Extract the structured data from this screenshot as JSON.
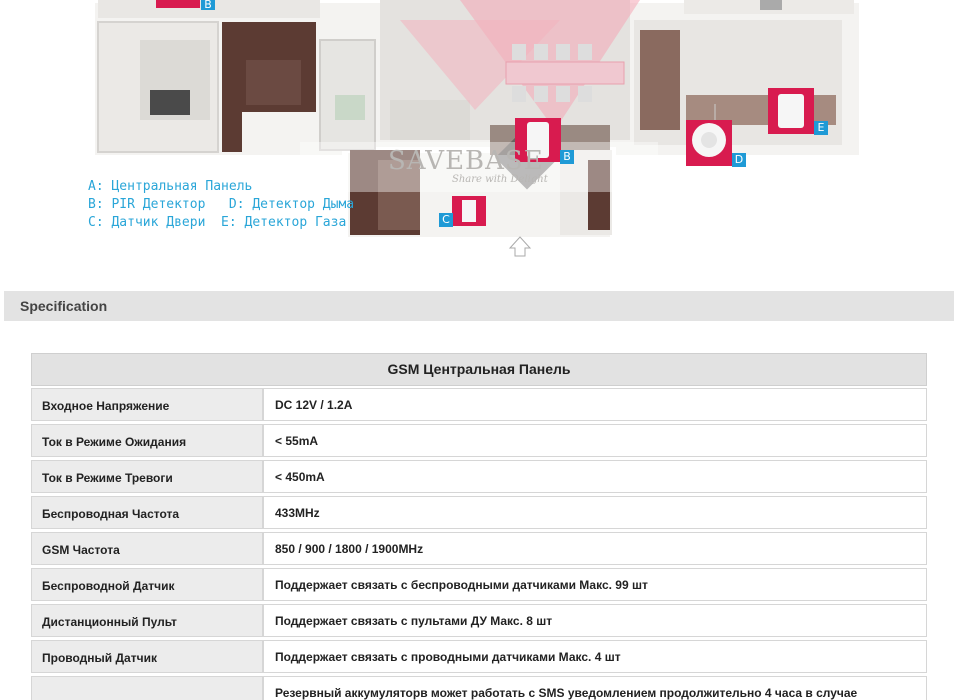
{
  "plan": {
    "watermark": "SAVEBASE",
    "watermark_sub": "Share with Delight",
    "markers": [
      "B",
      "B",
      "C",
      "D",
      "E"
    ],
    "legend": [
      "A: Центральная Панель",
      "B: PIR Детектор   D: Детектор Дыма",
      "C: Датчик Двери  E: Детектор Газа"
    ],
    "colors": {
      "legend_text": "#2aa6d8",
      "marker_bg": "#1f9ad6",
      "device_frame": "#d81b4f"
    }
  },
  "spec": {
    "title": "Specification"
  },
  "table": {
    "header": "GSM Центральная Панель",
    "rows": [
      {
        "label": "Входное Напряжение",
        "value": "DC 12V / 1.2A"
      },
      {
        "label": "Ток в Режиме Ожидания",
        "value": "< 55mA"
      },
      {
        "label": "Ток в Режиме Тревоги",
        "value": "< 450mA"
      },
      {
        "label": "Беспроводная Частота",
        "value": "433MHz"
      },
      {
        "label": "GSM Частота",
        "value": "850 / 900 / 1800 / 1900MHz"
      },
      {
        "label": "Беспроводной Датчик",
        "value": "Поддержает связать с беспроводными датчиками Макс. 99 шт"
      },
      {
        "label": "Дистанционный Пульт",
        "value": "Поддержает связать с пультами ДУ Макс. 8 шт"
      },
      {
        "label": "Проводный Датчик",
        "value": "Поддержает связать с проводными датчиками Макс. 4 шт"
      },
      {
        "label": "",
        "value": "Резервный аккумуляторв может работать с SMS уведомлением продолжительно 4 часа в случае"
      }
    ]
  }
}
